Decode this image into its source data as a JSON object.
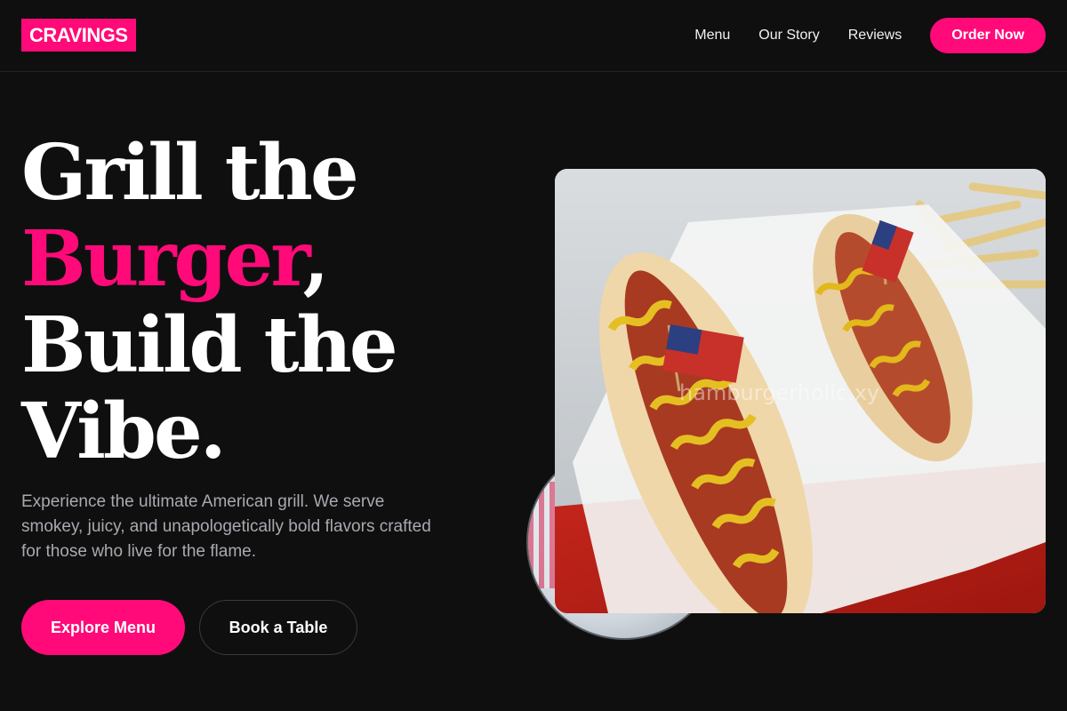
{
  "brand": {
    "logo_text": "CRAVINGS",
    "accent_color": "#ff0a78"
  },
  "nav": {
    "links": [
      "Menu",
      "Our Story",
      "Reviews"
    ],
    "cta_label": "Order Now"
  },
  "hero": {
    "title_line1": "Grill the",
    "title_accent": "Burger",
    "title_comma": ",",
    "title_line3": "Build the",
    "title_line4": "Vibe.",
    "description": "Experience the ultimate American grill. We serve smokey, juicy, and unapologetically bold flavors crafted for those who live for the flame.",
    "primary_cta": "Explore Menu",
    "secondary_cta": "Book a Table"
  },
  "photo": {
    "watermark": "hamburgerholic.xy"
  }
}
